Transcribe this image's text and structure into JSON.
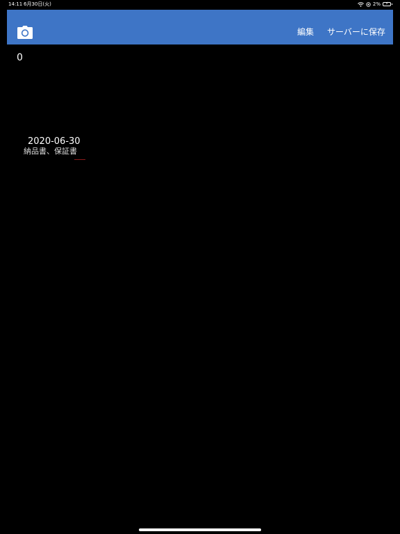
{
  "status_bar": {
    "time": "14:11",
    "date": "6月30日(火)",
    "battery": "2%"
  },
  "nav_bar": {
    "camera_icon": "camera-icon",
    "edit_label": "編集",
    "save_label": "サーバーに保存",
    "background_color": "#3e75c6"
  },
  "content": {
    "count": "0",
    "items": [
      {
        "date": "2020-06-30",
        "title": "納品書、保証書"
      }
    ]
  }
}
